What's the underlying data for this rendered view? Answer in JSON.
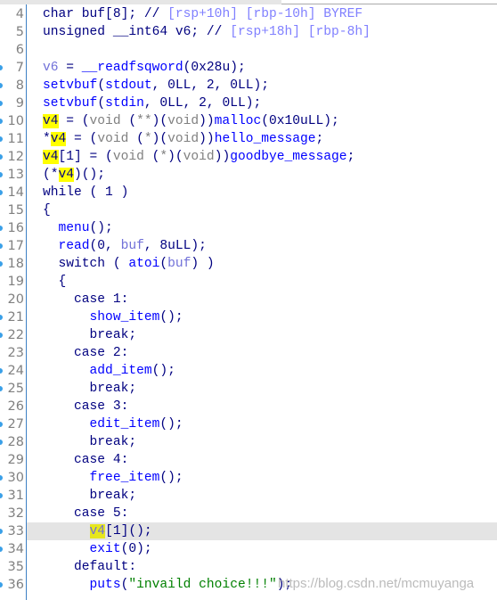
{
  "editor": {
    "current_line": 33,
    "highlight_color": "#ffff00",
    "lines": [
      {
        "n": 4,
        "dot": false,
        "t": [
          [
            "char buf[8]; ",
            "kw"
          ],
          [
            "// ",
            "cm"
          ],
          [
            "[rsp+10h] [rbp-10h] BYREF",
            "cmv"
          ]
        ]
      },
      {
        "n": 5,
        "dot": false,
        "t": [
          [
            "unsigned __int64 v6; ",
            "kw"
          ],
          [
            "// ",
            "cm"
          ],
          [
            "[rsp+18h] [rbp-8h]",
            "cmv"
          ]
        ]
      },
      {
        "n": 6,
        "dot": false,
        "t": []
      },
      {
        "n": 7,
        "dot": true,
        "t": [
          [
            "v6",
            "lv"
          ],
          [
            " = ",
            "kw"
          ],
          [
            "__readfsqword",
            "fn"
          ],
          [
            "(0x28u);",
            "kw"
          ]
        ]
      },
      {
        "n": 8,
        "dot": true,
        "t": [
          [
            "setvbuf",
            "fn"
          ],
          [
            "(",
            "kw"
          ],
          [
            "stdout",
            "fn"
          ],
          [
            ", 0LL, 2, 0LL);",
            "kw"
          ]
        ]
      },
      {
        "n": 9,
        "dot": true,
        "t": [
          [
            "setvbuf",
            "fn"
          ],
          [
            "(",
            "kw"
          ],
          [
            "stdin",
            "fn"
          ],
          [
            ", 0LL, 2, 0LL);",
            "kw"
          ]
        ]
      },
      {
        "n": 10,
        "dot": true,
        "t": [
          [
            "v4",
            "hl"
          ],
          [
            " = (",
            "kw"
          ],
          [
            "void",
            "ty"
          ],
          [
            " (",
            "kw"
          ],
          [
            "**",
            "ty"
          ],
          [
            ")(",
            "kw"
          ],
          [
            "void",
            "ty"
          ],
          [
            "))",
            "kw"
          ],
          [
            "malloc",
            "fn"
          ],
          [
            "(0x10uLL);",
            "kw"
          ]
        ]
      },
      {
        "n": 11,
        "dot": true,
        "t": [
          [
            "*",
            "kw"
          ],
          [
            "v4",
            "hl"
          ],
          [
            " = (",
            "kw"
          ],
          [
            "void",
            "ty"
          ],
          [
            " (",
            "kw"
          ],
          [
            "*",
            "ty"
          ],
          [
            ")(",
            "kw"
          ],
          [
            "void",
            "ty"
          ],
          [
            "))",
            "kw"
          ],
          [
            "hello_message",
            "fn"
          ],
          [
            ";",
            "kw"
          ]
        ]
      },
      {
        "n": 12,
        "dot": true,
        "t": [
          [
            "v4",
            "hl"
          ],
          [
            "[1] = (",
            "kw"
          ],
          [
            "void",
            "ty"
          ],
          [
            " (",
            "kw"
          ],
          [
            "*",
            "ty"
          ],
          [
            ")(",
            "kw"
          ],
          [
            "void",
            "ty"
          ],
          [
            "))",
            "kw"
          ],
          [
            "goodbye_message",
            "fn"
          ],
          [
            ";",
            "kw"
          ]
        ]
      },
      {
        "n": 13,
        "dot": true,
        "t": [
          [
            "(*",
            "kw"
          ],
          [
            "v4",
            "hl"
          ],
          [
            ")();",
            "kw"
          ]
        ]
      },
      {
        "n": 14,
        "dot": true,
        "t": [
          [
            "while ( 1 )",
            "kw"
          ]
        ]
      },
      {
        "n": 15,
        "dot": false,
        "t": [
          [
            "{",
            "kw"
          ]
        ]
      },
      {
        "n": 16,
        "dot": true,
        "t": [
          [
            "  ",
            "kw"
          ],
          [
            "menu",
            "fn"
          ],
          [
            "();",
            "kw"
          ]
        ]
      },
      {
        "n": 17,
        "dot": true,
        "t": [
          [
            "  ",
            "kw"
          ],
          [
            "read",
            "fn"
          ],
          [
            "(0, ",
            "kw"
          ],
          [
            "buf",
            "lv"
          ],
          [
            ", 8uLL);",
            "kw"
          ]
        ]
      },
      {
        "n": 18,
        "dot": true,
        "t": [
          [
            "  switch ( ",
            "kw"
          ],
          [
            "atoi",
            "fn"
          ],
          [
            "(",
            "kw"
          ],
          [
            "buf",
            "lv"
          ],
          [
            ") )",
            "kw"
          ]
        ]
      },
      {
        "n": 19,
        "dot": false,
        "t": [
          [
            "  {",
            "kw"
          ]
        ]
      },
      {
        "n": 20,
        "dot": false,
        "t": [
          [
            "    case 1:",
            "kw"
          ]
        ]
      },
      {
        "n": 21,
        "dot": true,
        "t": [
          [
            "      ",
            "kw"
          ],
          [
            "show_item",
            "fn"
          ],
          [
            "();",
            "kw"
          ]
        ]
      },
      {
        "n": 22,
        "dot": true,
        "t": [
          [
            "      break;",
            "kw"
          ]
        ]
      },
      {
        "n": 23,
        "dot": false,
        "t": [
          [
            "    case 2:",
            "kw"
          ]
        ]
      },
      {
        "n": 24,
        "dot": true,
        "t": [
          [
            "      ",
            "kw"
          ],
          [
            "add_item",
            "fn"
          ],
          [
            "();",
            "kw"
          ]
        ]
      },
      {
        "n": 25,
        "dot": true,
        "t": [
          [
            "      break;",
            "kw"
          ]
        ]
      },
      {
        "n": 26,
        "dot": false,
        "t": [
          [
            "    case 3:",
            "kw"
          ]
        ]
      },
      {
        "n": 27,
        "dot": true,
        "t": [
          [
            "      ",
            "kw"
          ],
          [
            "edit_item",
            "fn"
          ],
          [
            "();",
            "kw"
          ]
        ]
      },
      {
        "n": 28,
        "dot": true,
        "t": [
          [
            "      break;",
            "kw"
          ]
        ]
      },
      {
        "n": 29,
        "dot": false,
        "t": [
          [
            "    case 4:",
            "kw"
          ]
        ]
      },
      {
        "n": 30,
        "dot": true,
        "t": [
          [
            "      ",
            "kw"
          ],
          [
            "free_item",
            "fn"
          ],
          [
            "();",
            "kw"
          ]
        ]
      },
      {
        "n": 31,
        "dot": true,
        "t": [
          [
            "      break;",
            "kw"
          ]
        ]
      },
      {
        "n": 32,
        "dot": false,
        "t": [
          [
            "    case 5:",
            "kw"
          ]
        ]
      },
      {
        "n": 33,
        "dot": true,
        "t": [
          [
            "      ",
            "kw"
          ],
          [
            "v4",
            "hl2 lv"
          ],
          [
            "[1]();",
            "kw"
          ]
        ]
      },
      {
        "n": 34,
        "dot": true,
        "t": [
          [
            "      ",
            "kw"
          ],
          [
            "exit",
            "fn"
          ],
          [
            "(0);",
            "kw"
          ]
        ]
      },
      {
        "n": 35,
        "dot": false,
        "t": [
          [
            "    default:",
            "kw"
          ]
        ]
      },
      {
        "n": 36,
        "dot": true,
        "t": [
          [
            "      ",
            "kw"
          ],
          [
            "puts",
            "fn"
          ],
          [
            "(",
            "kw"
          ],
          [
            "\"invaild choice!!!\"",
            "str"
          ],
          [
            ");",
            "kw"
          ]
        ]
      }
    ]
  },
  "watermark": "https://blog.csdn.net/mcmuyanga"
}
